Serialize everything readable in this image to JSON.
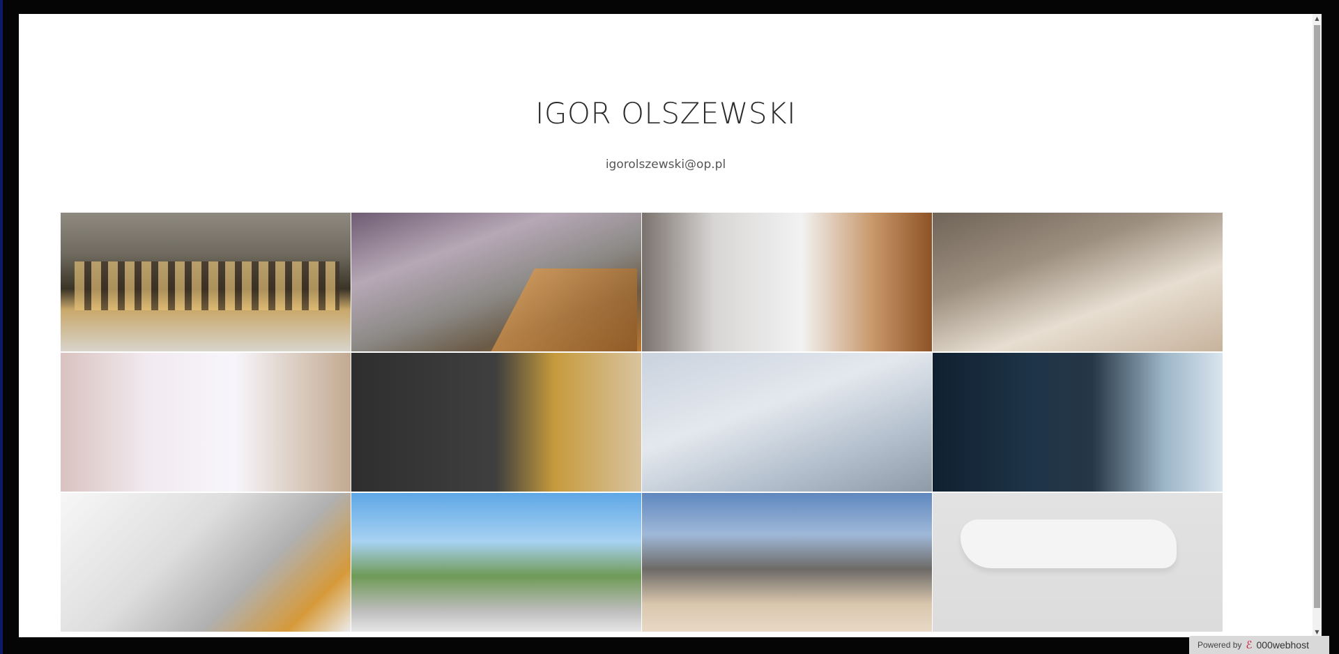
{
  "header": {
    "title": "IGOR OLSZEWSKI",
    "email": "igorolszewski@op.pl"
  },
  "gallery": {
    "count": 12,
    "columns": 4,
    "rows": 3
  },
  "badge": {
    "powered_label": "Powered by",
    "brand": "000webhost",
    "icon": "000webhost-logo-icon"
  },
  "scrollbar": {
    "up_icon": "scroll-up-arrow-icon",
    "down_icon": "scroll-down-arrow-icon"
  },
  "colors": {
    "page_background": "#ffffff",
    "frame": "#050505",
    "title_text": "#2b2b2b",
    "email_text": "#555555",
    "badge_background": "#d9d9d9",
    "badge_logo": "#c8102e"
  }
}
